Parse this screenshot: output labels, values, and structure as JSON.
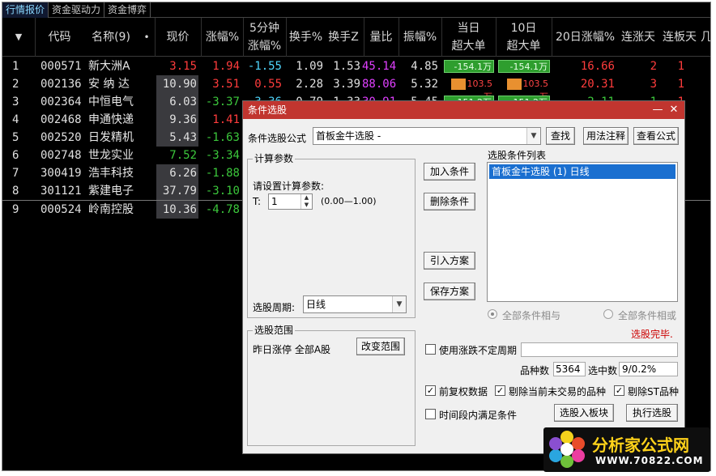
{
  "tabs": [
    "行情报价",
    "资金驱动力",
    "资金博弈"
  ],
  "columns": {
    "sort": "▼",
    "code": "代码",
    "name": "名称(9)",
    "name_dot": "•",
    "price": "现价",
    "change": "涨幅%",
    "change5_l1": "5分钟",
    "change5_l2": "涨幅%",
    "turnover": "换手%",
    "turnover_z": "换手Z",
    "volume_ratio": "量比",
    "amplitude": "振幅%",
    "big_today_l1": "当日",
    "big_today_l2": "超大单",
    "big10_l1": "10日",
    "big10_l2": "超大单",
    "change20": "20日涨幅%",
    "up_days": "连涨天",
    "limit_days": "连板天",
    "extra": "几"
  },
  "rows": [
    {
      "idx": "1",
      "code": "000571",
      "name": "新大洲A",
      "price": "3.15",
      "change": "1.94",
      "change5": "-1.55",
      "turnover": "1.09",
      "turnover_z": "1.53",
      "volume_ratio": "45.14",
      "amplitude": "4.85",
      "big_today": "-154.1万",
      "big10": "-154.1万",
      "change20": "16.66",
      "up_days": "2",
      "limit_days": "1"
    },
    {
      "idx": "2",
      "code": "002136",
      "name": "安 纳 达",
      "price": "10.90",
      "change": "3.51",
      "change5": "0.55",
      "turnover": "2.28",
      "turnover_z": "3.39",
      "volume_ratio": "88.06",
      "amplitude": "5.32",
      "big_today": "103.5万",
      "big10": "103.5万",
      "change20": "20.31",
      "up_days": "3",
      "limit_days": "1"
    },
    {
      "idx": "3",
      "code": "002364",
      "name": "中恒电气",
      "price": "6.03",
      "change": "-3.37",
      "change5": "-3.36",
      "turnover": "0.79",
      "turnover_z": "1.33",
      "volume_ratio": "30.91",
      "amplitude": "5.45",
      "big_today": "-151.2万",
      "big10": "-151.2万",
      "change20": "-2.11",
      "up_days": "-1",
      "limit_days": "1"
    },
    {
      "idx": "4",
      "code": "002468",
      "name": "申通快递",
      "price": "9.36",
      "change": "1.41"
    },
    {
      "idx": "5",
      "code": "002520",
      "name": "日发精机",
      "price": "5.43",
      "change": "-1.63"
    },
    {
      "idx": "6",
      "code": "002748",
      "name": "世龙实业",
      "price": "7.52",
      "change": "-3.34"
    },
    {
      "idx": "7",
      "code": "300419",
      "name": "浩丰科技",
      "price": "6.26",
      "change": "-1.88"
    },
    {
      "idx": "8",
      "code": "301121",
      "name": "紫建电子",
      "price": "37.79",
      "change": "-3.10"
    },
    {
      "idx": "9",
      "code": "000524",
      "name": "岭南控股",
      "price": "10.36",
      "change": "-4.78"
    }
  ],
  "dialog": {
    "title": "条件选股",
    "minimize": "—",
    "close": "✕",
    "formula_label": "条件选股公式",
    "formula_value": "首板金牛选股 -",
    "find_btn": "查找",
    "usage_btn": "用法注释",
    "view_btn": "查看公式",
    "calc_group": "计算参数",
    "set_params": "请设置计算参数:",
    "param_name": "T:",
    "param_value": "1",
    "param_range": "(0.00—1.00)",
    "period_label": "选股周期:",
    "period_value": "日线",
    "add_btn": "加入条件",
    "delete_btn": "删除条件",
    "import_btn": "引入方案",
    "save_btn": "保存方案",
    "list_title": "选股条件列表",
    "list_items": [
      "首板金牛选股 (1) 日线"
    ],
    "radio_and": "全部条件相与",
    "radio_or": "全部条件相或",
    "status": "选股完毕.",
    "range_group": "选股范围",
    "range_text": "昨日涨停 全部A股",
    "change_range_btn": "改变范围",
    "use_uncertain_period": "使用涨跌不定周期",
    "count_label": "品种数",
    "count_value": "5364",
    "selected_label": "选中数",
    "selected_value": "9/0.2%",
    "forward_adjusted": "前复权数据",
    "exclude_untraded": "剔除当前未交易的品种",
    "exclude_st": "剔除ST品种",
    "time_satisfied": "时间段内满足条件",
    "to_block_btn": "选股入板块",
    "execute_btn": "执行选股",
    "colors": {
      "title_bar": "#c1352f",
      "selection": "#1a6fd0",
      "status": "#cc0000"
    }
  },
  "logo": {
    "name": "分析家公式网",
    "url_text": "WWW.70822.COM"
  }
}
